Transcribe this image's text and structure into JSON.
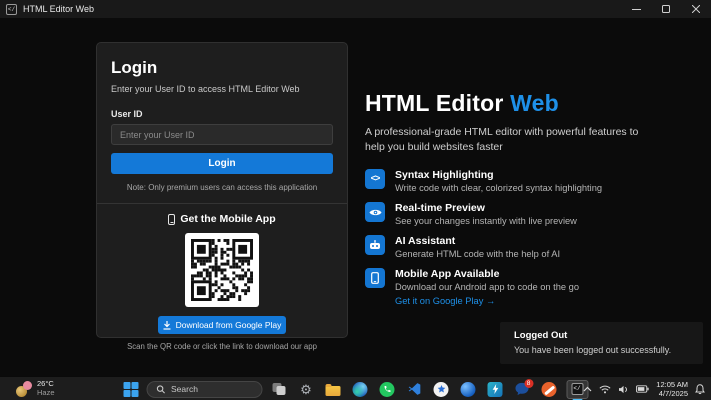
{
  "window": {
    "title": "HTML Editor Web"
  },
  "login": {
    "heading": "Login",
    "subheading": "Enter your User ID to access HTML Editor Web",
    "user_id_label": "User ID",
    "user_id_placeholder": "Enter your User ID",
    "login_button": "Login",
    "note": "Note: Only premium users can access this application"
  },
  "mobile": {
    "heading": "Get the Mobile App",
    "download_button": "Download from Google Play",
    "hint": "Scan the QR code or click the link to download our app"
  },
  "hero": {
    "title_main": "HTML Editor ",
    "title_accent": "Web",
    "description": "A professional-grade HTML editor with powerful features to help you build websites faster",
    "accent_color": "#1e90e8"
  },
  "features": [
    {
      "icon": "code-icon",
      "glyph": "<>",
      "title": "Syntax Highlighting",
      "description": "Write code with clear, colorized syntax highlighting"
    },
    {
      "icon": "eye-icon",
      "title": "Real-time Preview",
      "description": "See your changes instantly with live preview"
    },
    {
      "icon": "robot-icon",
      "title": "AI Assistant",
      "description": "Generate HTML code with the help of AI"
    },
    {
      "icon": "phone-icon",
      "title": "Mobile App Available",
      "description": "Download our Android app to code on the go",
      "link": "Get it on Google Play →"
    }
  ],
  "toast": {
    "title": "Logged Out",
    "message": "You have been logged out successfully."
  },
  "taskbar": {
    "weather": {
      "temp": "26°C",
      "condition": "Haze"
    },
    "search_placeholder": "Search",
    "apps": [
      "task-view",
      "settings",
      "file-explorer",
      "edge",
      "whatsapp",
      "vscode",
      "light-circle-app",
      "blue-sphere-app",
      "lightning-app",
      "chat-app",
      "orange-app",
      "html-editor-active"
    ],
    "chat_badge_count": "8",
    "tray": {
      "time": "12:05 AM",
      "date": "4/7/2025"
    }
  },
  "colors": {
    "accent_blue": "#1479d8",
    "taskbar_bg": "#1d1d1d",
    "card_bg": "#1e1e1e"
  }
}
